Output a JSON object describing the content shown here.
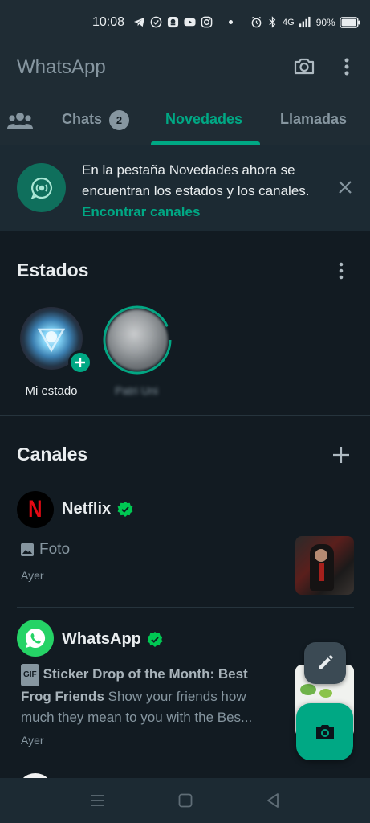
{
  "status_bar": {
    "time": "10:08",
    "network": "4G",
    "battery": "90%"
  },
  "app": {
    "title": "WhatsApp"
  },
  "tabs": {
    "chats": {
      "label": "Chats",
      "badge": "2"
    },
    "novedades": {
      "label": "Novedades",
      "active": true
    },
    "llamadas": {
      "label": "Llamadas"
    }
  },
  "banner": {
    "text": "En la pestaña Novedades ahora se encuentran los estados y los canales.",
    "link": "Encontrar canales"
  },
  "estados": {
    "title": "Estados",
    "items": [
      {
        "label": "Mi estado"
      },
      {
        "label": "Patri Uni"
      }
    ]
  },
  "canales": {
    "title": "Canales",
    "items": [
      {
        "name": "Netflix",
        "media_label": "Foto",
        "time": "Ayer"
      },
      {
        "name": "WhatsApp",
        "gif_tag": "GIF",
        "message_bold": "Sticker Drop of the Month: Best Frog Friends",
        "message_rest": "Show your friends how much they mean to you with the Bes...",
        "time": "Ayer"
      }
    ]
  },
  "colors": {
    "accent": "#00a884",
    "background": "#121b22",
    "header": "#1f2c34",
    "text_secondary": "#8696a0"
  },
  "icons": [
    "camera-icon",
    "more-vert-icon",
    "community-icon",
    "channel-icon",
    "close-icon",
    "add-icon",
    "verified-icon",
    "image-icon",
    "pencil-icon",
    "nav-menu-icon",
    "nav-home-icon",
    "nav-back-icon"
  ]
}
